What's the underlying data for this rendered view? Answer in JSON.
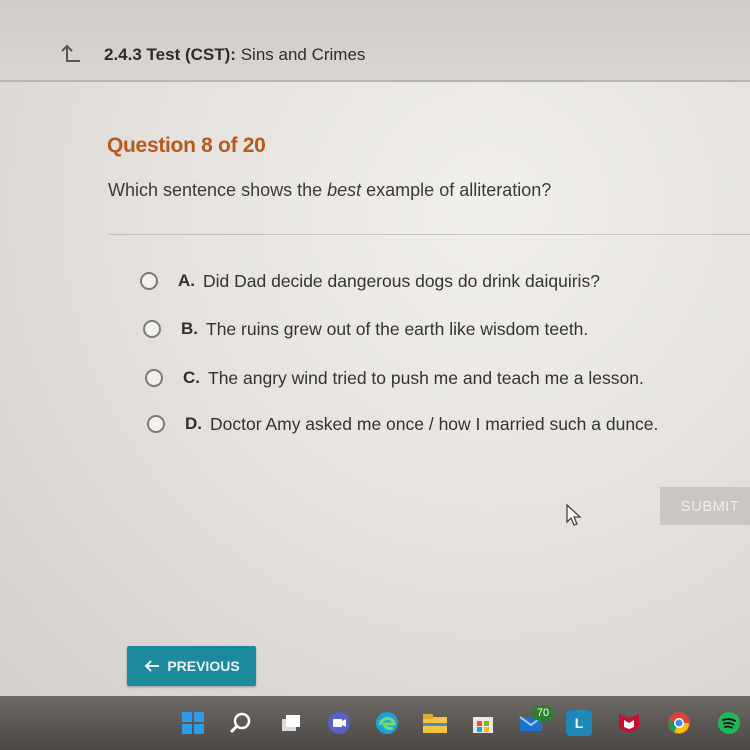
{
  "header": {
    "back_icon": "up-arrow-icon",
    "code": "2.4.3",
    "type": "Test (CST)",
    "separator": ":",
    "title": "Sins and Crimes"
  },
  "question": {
    "number_label": "Question 8 of 20",
    "prompt_before": "Which sentence shows the ",
    "prompt_emphasis": "best",
    "prompt_after": " example of alliteration?"
  },
  "options": [
    {
      "letter": "A.",
      "text": "Did Dad decide dangerous dogs do drink daiquiris?",
      "selected": false
    },
    {
      "letter": "B.",
      "text": "The ruins grew out of the earth like wisdom teeth.",
      "selected": false
    },
    {
      "letter": "C.",
      "text": "The angry wind tried to push me and teach me a lesson.",
      "selected": false
    },
    {
      "letter": "D.",
      "text": "Doctor Amy asked me once / how I married such a dunce.",
      "selected": false
    }
  ],
  "actions": {
    "submit_label": "SUBMIT",
    "previous_label": "PREVIOUS"
  },
  "taskbar": {
    "icons": [
      "windows-start-icon",
      "search-icon",
      "task-view-icon",
      "video-chat-icon",
      "edge-browser-icon",
      "file-explorer-icon",
      "store-icon",
      "mail-icon",
      "l-app-icon",
      "mcafee-icon",
      "chrome-icon",
      "spotify-icon"
    ],
    "mail_badge": "70",
    "l_app_label": "L"
  },
  "colors": {
    "question_number": "#b85a1e",
    "previous_button": "#1c8a9c",
    "submit_disabled": "#cac7c3"
  }
}
